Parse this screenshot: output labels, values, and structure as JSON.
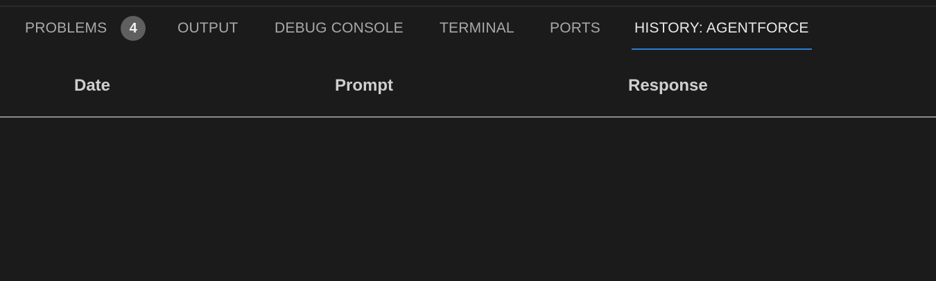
{
  "tabs": {
    "problems": {
      "label": "PROBLEMS",
      "badge": "4"
    },
    "output": {
      "label": "OUTPUT"
    },
    "debug_console": {
      "label": "DEBUG CONSOLE"
    },
    "terminal": {
      "label": "TERMINAL"
    },
    "ports": {
      "label": "PORTS"
    },
    "history": {
      "label": "HISTORY: AGENTFORCE",
      "active": true
    }
  },
  "table": {
    "columns": [
      "Date",
      "Prompt",
      "Response"
    ],
    "rows": []
  },
  "colors": {
    "background": "#1b1b1b",
    "active_tab_underline": "#2f7fd0",
    "badge": "#5f5f5f"
  }
}
